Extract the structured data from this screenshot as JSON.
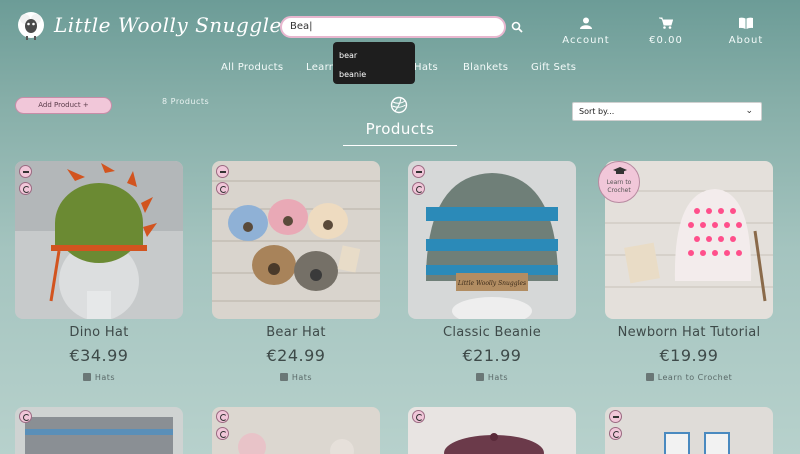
{
  "header": {
    "logo_text": "Little Woolly Snuggles",
    "search_value": "Bea|",
    "account_label": "Account",
    "cart_label": "€0.00",
    "about_label": "About"
  },
  "suggestions": [
    "bear",
    "beanie"
  ],
  "menu": {
    "items": [
      "All Products",
      "Learn",
      "Hats",
      "Blankets",
      "Gift Sets"
    ]
  },
  "controls": {
    "add_product_label": "Add Product  +",
    "product_count": "8 Products",
    "sort_value": "Sort by...",
    "section_title": "Products"
  },
  "products": [
    {
      "name": "Dino Hat",
      "price": "€34.99",
      "category": "Hats"
    },
    {
      "name": "Bear Hat",
      "price": "€24.99",
      "category": "Hats"
    },
    {
      "name": "Classic Beanie",
      "price": "€21.99",
      "category": "Hats"
    },
    {
      "name": "Newborn Hat Tutorial",
      "price": "€19.99",
      "category": "Learn to Crochet"
    }
  ],
  "badge": {
    "line1": "Learn to",
    "line2": "Crochet"
  },
  "label_tag": "Little Woolly Snuggles",
  "colors": {
    "accent_pink": "#f1c7d9",
    "bg_teal": "#86aea8",
    "text_dark": "#3e4a49"
  }
}
